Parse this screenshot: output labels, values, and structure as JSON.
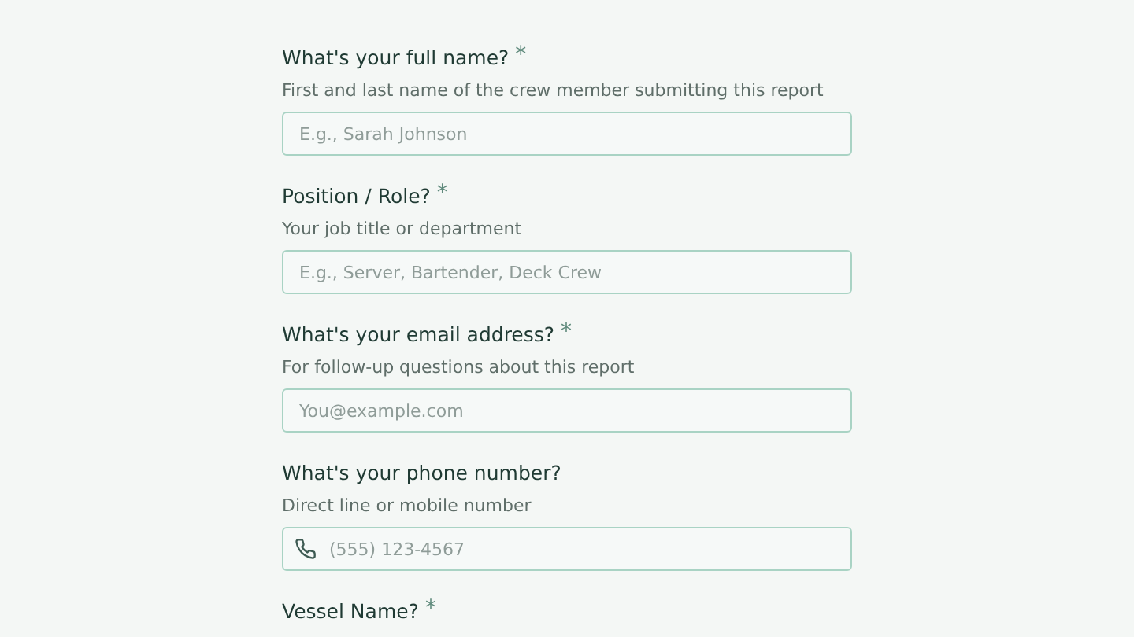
{
  "required_marker": "*",
  "fields": [
    {
      "kind": "text",
      "label": "What's your full name?",
      "required": true,
      "hint": "First and last name of the crew member submitting this report",
      "placeholder": "E.g., Sarah Johnson"
    },
    {
      "kind": "text",
      "label": "Position / Role?",
      "required": true,
      "hint": "Your job title or department",
      "placeholder": "E.g., Server, Bartender, Deck Crew"
    },
    {
      "kind": "text",
      "label": "What's your email address?",
      "required": true,
      "hint": "For follow-up questions about this report",
      "placeholder": "You@example.com"
    },
    {
      "kind": "phone",
      "label": "What's your phone number?",
      "required": false,
      "hint": "Direct line or mobile number",
      "placeholder": "(555) 123-4567"
    },
    {
      "kind": "text",
      "label": "Vessel Name?",
      "required": true
    }
  ]
}
